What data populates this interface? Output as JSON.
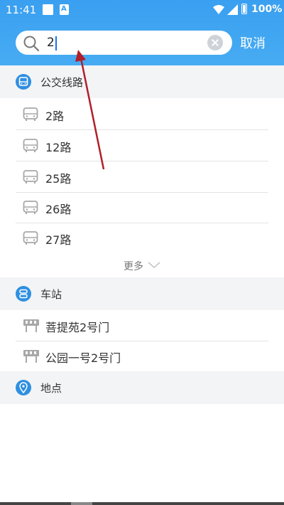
{
  "status_bar": {
    "time": "11:41",
    "battery": "100%",
    "icons": [
      "square-icon",
      "a-notification-icon",
      "wifi-icon",
      "signal-icon",
      "battery-icon"
    ]
  },
  "search": {
    "value": "2",
    "placeholder": "",
    "cancel_label": "取消"
  },
  "sections": {
    "bus_lines": {
      "title": "公交线路",
      "icon": "bus-icon",
      "items": [
        {
          "label": "2路"
        },
        {
          "label": "12路"
        },
        {
          "label": "25路"
        },
        {
          "label": "26路"
        },
        {
          "label": "27路"
        }
      ],
      "more_label": "更多"
    },
    "stations": {
      "title": "车站",
      "icon": "station-icon",
      "items": [
        {
          "label": "菩提苑2号门"
        },
        {
          "label": "公园一号2号门"
        }
      ]
    },
    "places": {
      "title": "地点",
      "icon": "location-pin-icon"
    }
  },
  "colors": {
    "header": "#3a9ff0",
    "accent": "#2f8fe0",
    "annotation_arrow": "#b01f2a"
  }
}
